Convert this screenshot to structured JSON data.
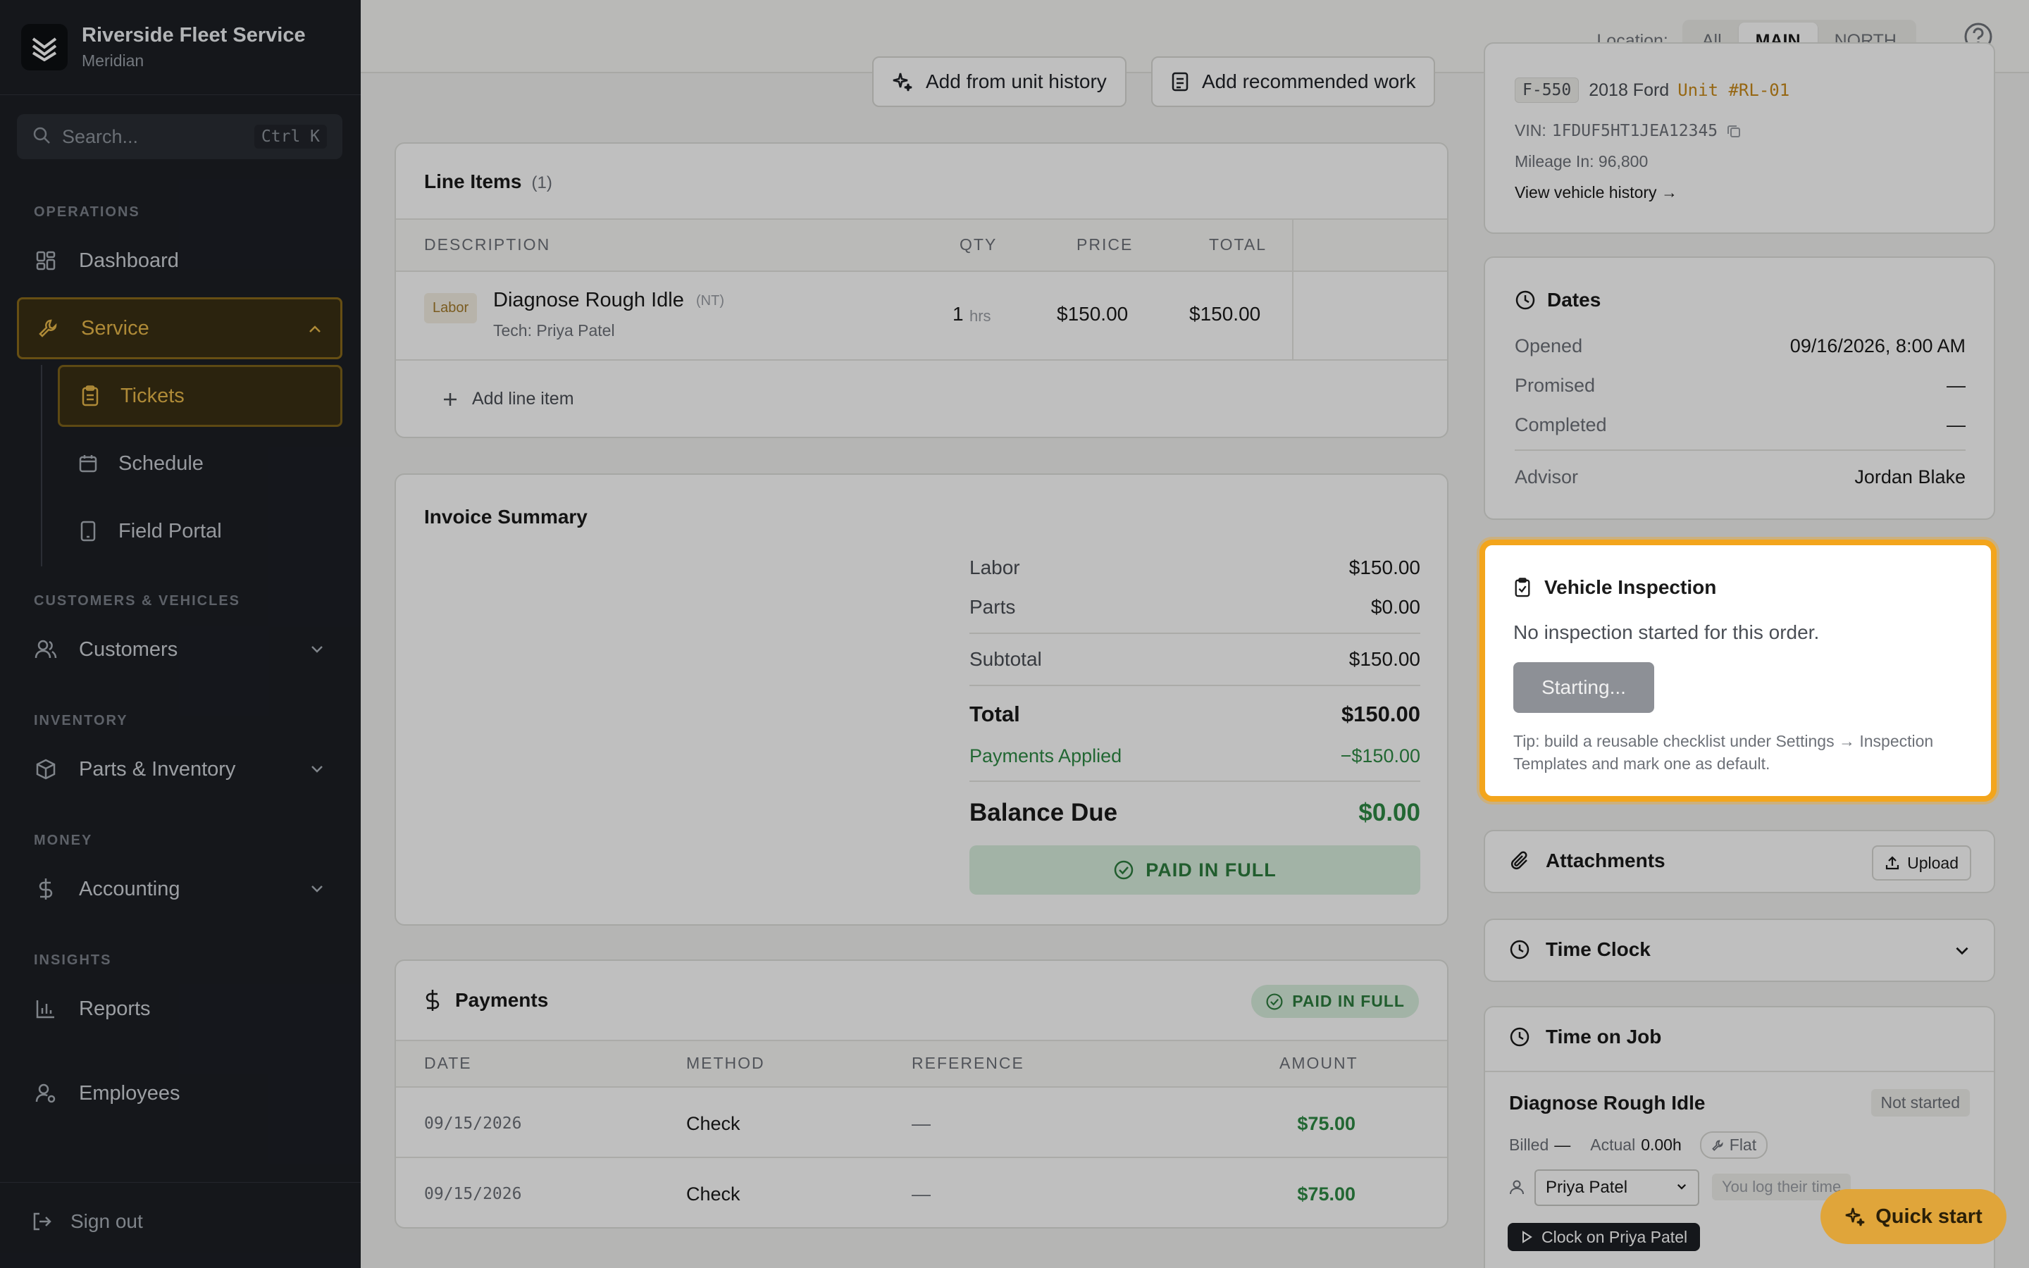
{
  "brand": {
    "name": "Riverside Fleet Service",
    "sub": "Meridian"
  },
  "search": {
    "placeholder": "Search...",
    "shortcut": "Ctrl K"
  },
  "sidebar": {
    "sections": [
      "OPERATIONS",
      "CUSTOMERS & VEHICLES",
      "INVENTORY",
      "MONEY",
      "INSIGHTS"
    ],
    "items": {
      "dashboard": "Dashboard",
      "service": "Service",
      "tickets": "Tickets",
      "schedule": "Schedule",
      "field_portal": "Field Portal",
      "customers": "Customers",
      "parts": "Parts & Inventory",
      "accounting": "Accounting",
      "reports": "Reports",
      "employees": "Employees"
    },
    "signout": "Sign out"
  },
  "topbar": {
    "location_label": "Location:",
    "options": [
      "All",
      "MAIN",
      "NORTH"
    ],
    "selected": "MAIN"
  },
  "actions": {
    "unit_history": "Add from unit history",
    "recommended": "Add recommended work"
  },
  "line_items": {
    "title": "Line Items",
    "count": "(1)",
    "headers": [
      "DESCRIPTION",
      "QTY",
      "PRICE",
      "TOTAL"
    ],
    "rows": [
      {
        "tag": "Labor",
        "desc": "Diagnose Rough Idle",
        "badge": "(NT)",
        "tech": "Tech: Priya Patel",
        "qty": "1",
        "unit": "hrs",
        "price": "$150.00",
        "total": "$150.00"
      }
    ],
    "add": "Add line item"
  },
  "invoice": {
    "title": "Invoice Summary",
    "labor_label": "Labor",
    "labor": "$150.00",
    "parts_label": "Parts",
    "parts": "$0.00",
    "subtotal_label": "Subtotal",
    "subtotal": "$150.00",
    "total_label": "Total",
    "total": "$150.00",
    "payments_label": "Payments Applied",
    "payments": "−$150.00",
    "balance_label": "Balance Due",
    "balance": "$0.00",
    "status": "PAID IN FULL"
  },
  "payments": {
    "title": "Payments",
    "status": "PAID IN FULL",
    "headers": [
      "DATE",
      "METHOD",
      "REFERENCE",
      "AMOUNT"
    ],
    "rows": [
      {
        "date": "09/15/2026",
        "method": "Check",
        "ref": "—",
        "amount": "$75.00"
      },
      {
        "date": "09/15/2026",
        "method": "Check",
        "ref": "—",
        "amount": "$75.00"
      }
    ]
  },
  "vehicle": {
    "model_code": "F-550",
    "year_make": "2018 Ford",
    "unit": "Unit #RL-01",
    "vin_label": "VIN:",
    "vin": "1FDUF5HT1JEA12345",
    "mileage": "Mileage In: 96,800",
    "history_link": "View vehicle history →"
  },
  "dates": {
    "title": "Dates",
    "opened_label": "Opened",
    "opened": "09/16/2026, 8:00 AM",
    "promised_label": "Promised",
    "promised": "—",
    "completed_label": "Completed",
    "completed": "—",
    "advisor_label": "Advisor",
    "advisor": "Jordan Blake"
  },
  "inspection": {
    "title": "Vehicle Inspection",
    "message": "No inspection started for this order.",
    "button": "Starting...",
    "tip_line1": "Tip: build a reusable checklist under Settings → Inspection",
    "tip_line2": "Templates and mark one as default."
  },
  "attachments": {
    "title": "Attachments",
    "upload": "Upload"
  },
  "timeclock": {
    "title": "Time Clock"
  },
  "timeonjob": {
    "title": "Time on Job",
    "job": "Diagnose Rough Idle",
    "status": "Not started",
    "billed_label": "Billed",
    "billed": "—",
    "actual_label": "Actual",
    "actual": "0.00h",
    "flat": "Flat",
    "tech": "Priya Patel",
    "hint": "You log their time",
    "clock_btn": "Clock on Priya Patel"
  },
  "quick_start": "Quick start",
  "colors": {
    "accent": "#f3a51c",
    "sidebar": "#1c1f25",
    "success": "#2e8a44"
  }
}
